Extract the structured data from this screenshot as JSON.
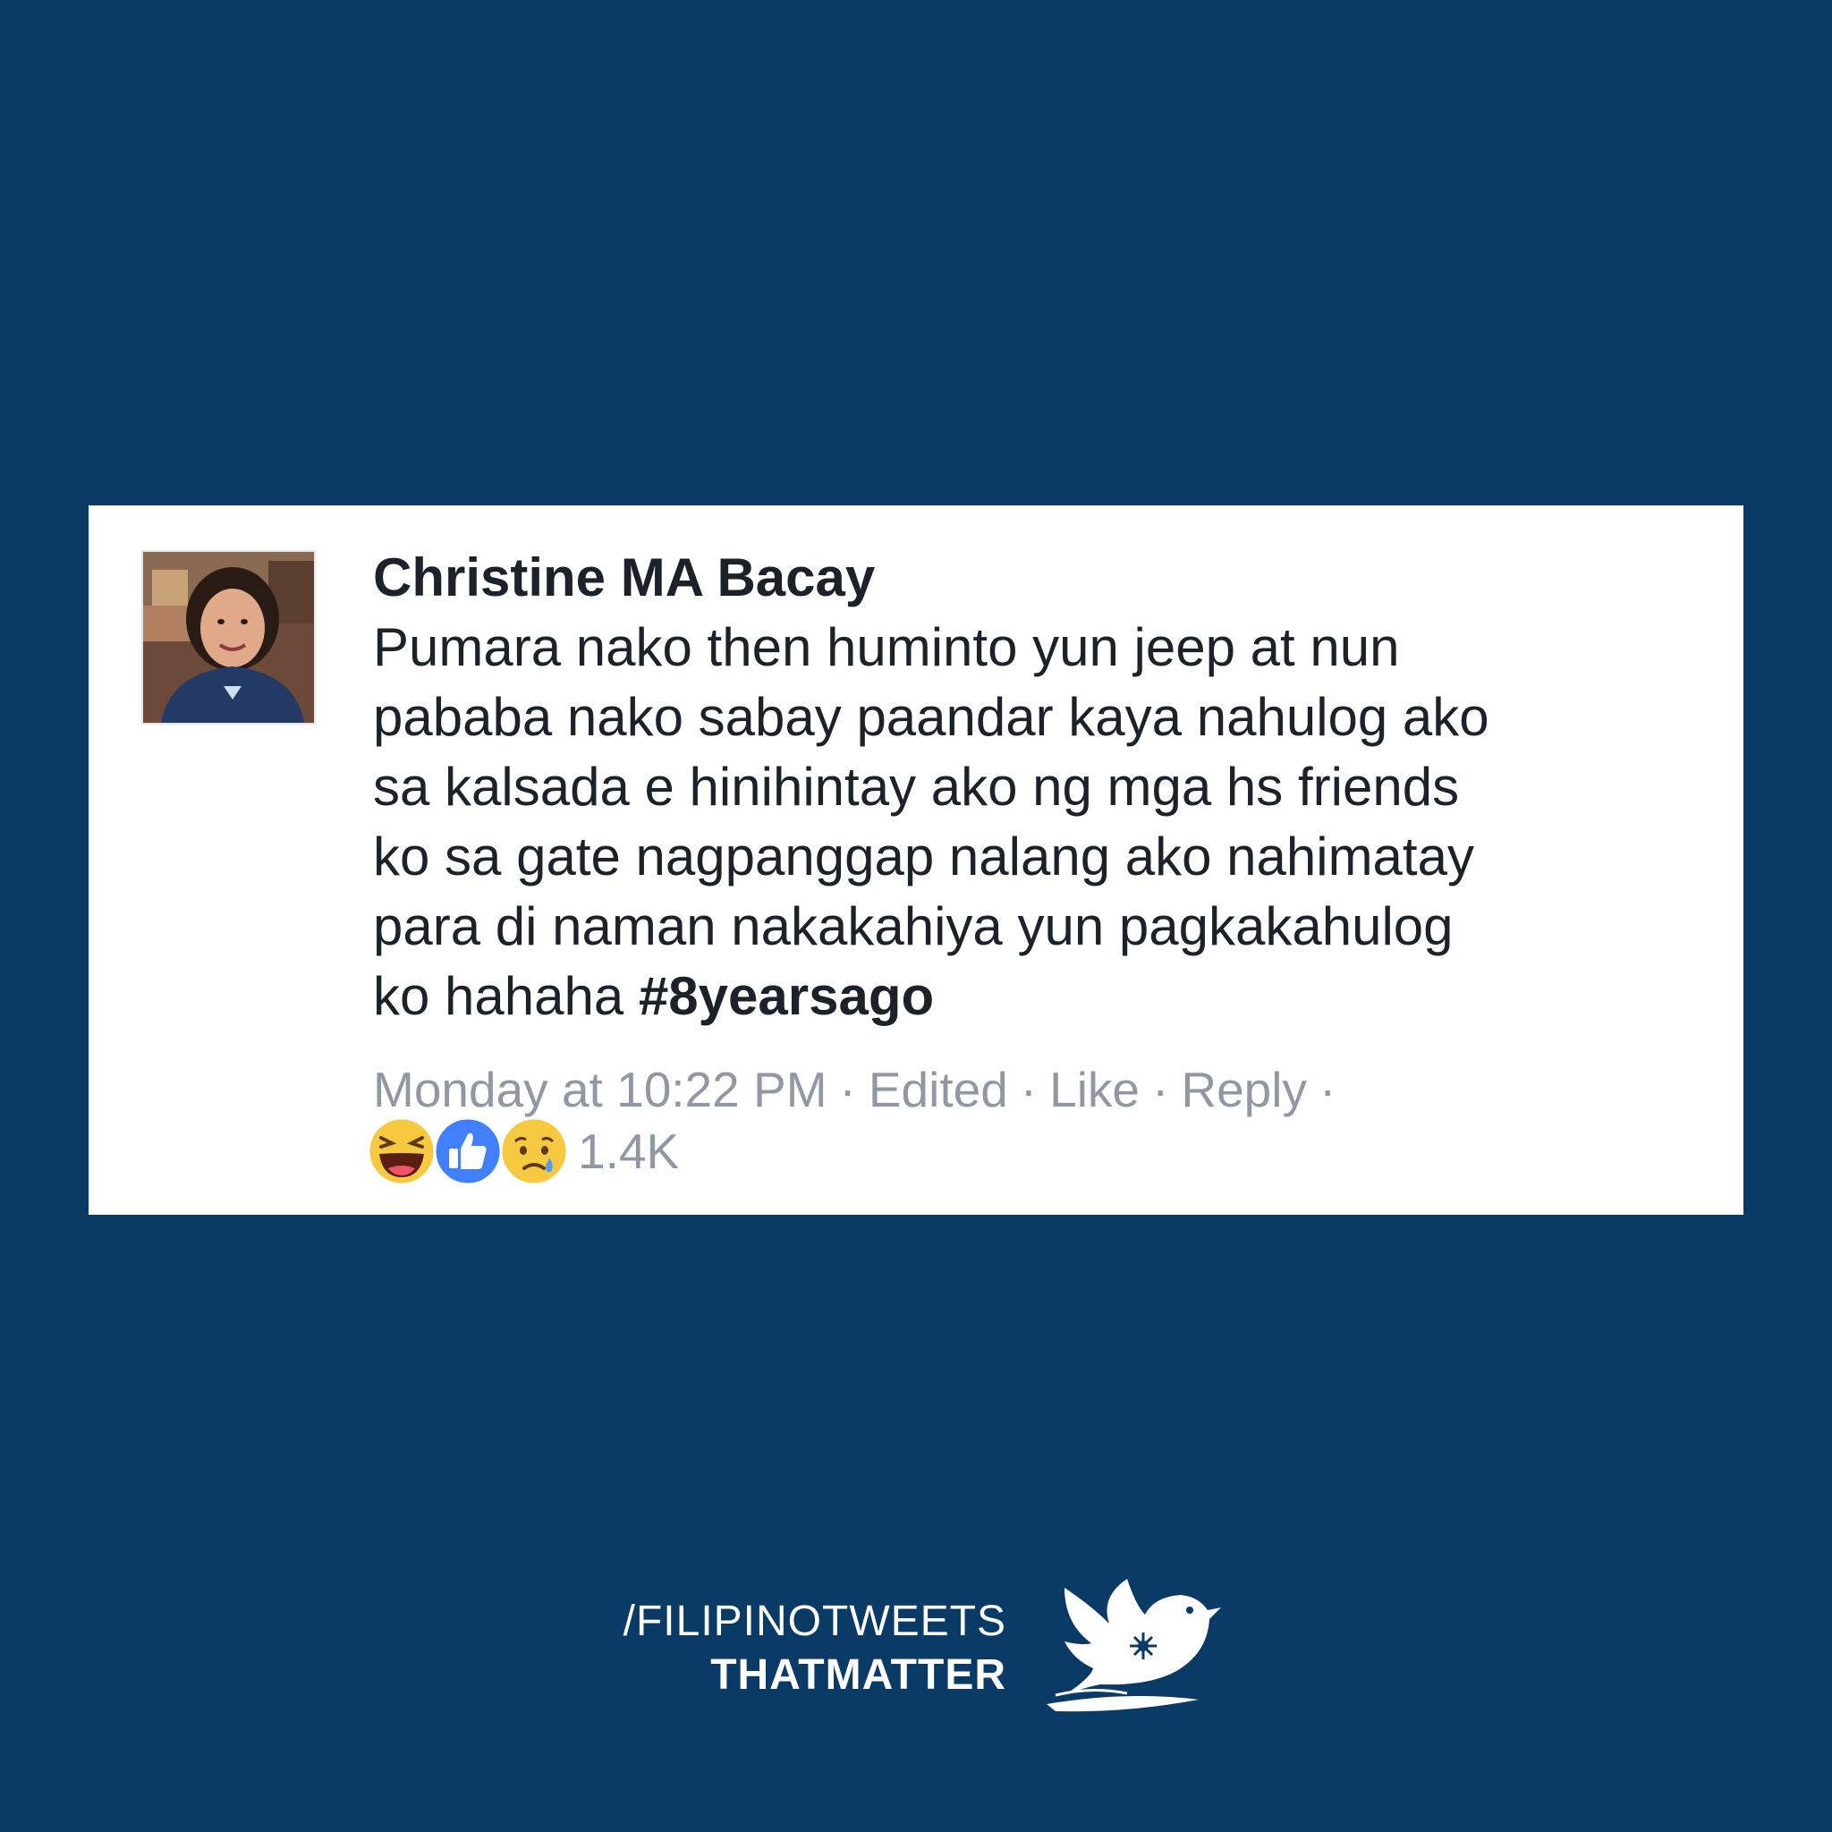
{
  "post": {
    "author": "Christine MA Bacay",
    "body_lines": [
      "Pumara nako then huminto yun jeep at nun",
      "pababa nako sabay paandar kaya nahulog ako",
      "sa kalsada e hinihintay ako ng mga hs friends",
      "ko sa gate nagpanggap nalang ako nahimatay",
      "para di naman nakakahiya yun pagkakahulog"
    ],
    "last_line_prefix": "ko hahaha ",
    "hashtag": "#8yearsago",
    "timestamp": "Monday at 10:22 PM",
    "edited_label": "Edited",
    "like_label": "Like",
    "reply_label": "Reply",
    "separator": "·",
    "reactions": {
      "icons": [
        "haha-reaction-icon",
        "like-reaction-icon",
        "sad-reaction-icon"
      ],
      "count": "1.4K"
    }
  },
  "branding": {
    "line1": "/FILIPINOTWEETS",
    "line2": "THATMATTER",
    "icon": "bird-icon"
  },
  "colors": {
    "background": "#0a3a66",
    "card": "#ffffff",
    "text": "#1d2129",
    "meta": "#9197a3",
    "like_blue": "#4080ff",
    "emoji_yellow": "#f7c940"
  }
}
